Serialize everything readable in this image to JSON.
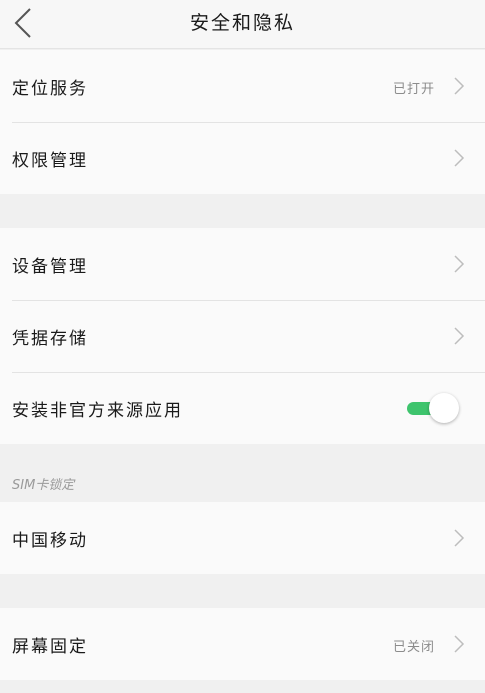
{
  "header": {
    "title": "安全和隐私"
  },
  "groups": [
    [
      {
        "label": "定位服务",
        "value": "已打开"
      },
      {
        "label": "权限管理",
        "value": ""
      }
    ],
    [
      {
        "label": "设备管理",
        "value": ""
      },
      {
        "label": "凭据存储",
        "value": ""
      },
      {
        "label": "安装非官方来源应用",
        "toggle_on": true
      }
    ],
    [
      {
        "label": "中国移动",
        "value": ""
      }
    ],
    [
      {
        "label": "屏幕固定",
        "value": "已关闭"
      }
    ]
  ],
  "sim_section_title": "SIM卡锁定",
  "colors": {
    "toggle_on": "#3ec46d",
    "chevron": "#bdbdbd"
  }
}
